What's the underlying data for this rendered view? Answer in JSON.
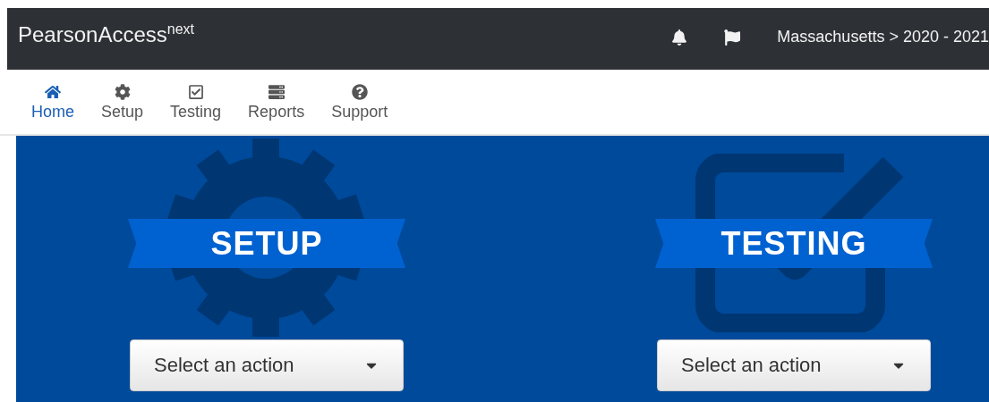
{
  "header": {
    "brand": "PearsonAccess$^{next}$",
    "breadcrumb": "Massachusetts > 2020 - 2021"
  },
  "nav": [
    {
      "label": "Home",
      "kind": "home",
      "selected": true
    },
    {
      "label": "Setup",
      "kind": "setup",
      "selected": false
    },
    {
      "label": "Testing",
      "kind": "testing",
      "selected": false
    },
    {
      "label": "Reports",
      "kind": "reports",
      "selected": false
    },
    {
      "label": "Support",
      "kind": "support",
      "selected": false
    }
  ],
  "cards": [
    {
      "kind": "gear",
      "title": "SETUP",
      "action": "Select an action"
    },
    {
      "kind": "checkbox",
      "title": "TESTING",
      "action": "Select an action"
    }
  ]
}
